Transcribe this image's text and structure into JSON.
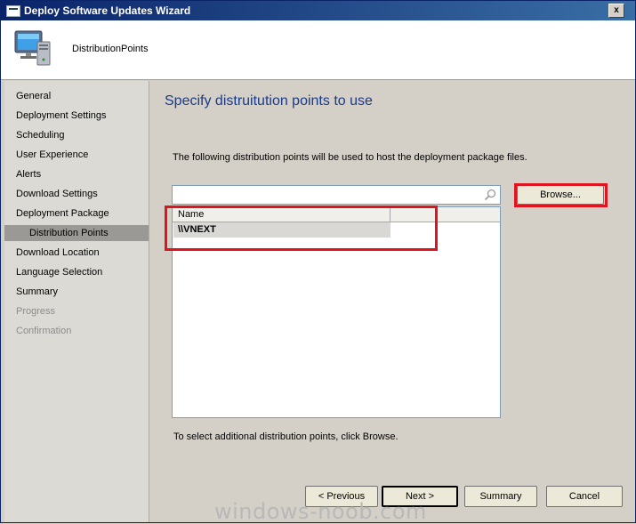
{
  "window": {
    "title": "Deploy Software Updates Wizard",
    "close_glyph": "x"
  },
  "header": {
    "page_name": "DistributionPoints",
    "icon": "computer-icon"
  },
  "sidebar": {
    "items": [
      {
        "label": "General",
        "state": "normal"
      },
      {
        "label": "Deployment Settings",
        "state": "normal"
      },
      {
        "label": "Scheduling",
        "state": "normal"
      },
      {
        "label": "User Experience",
        "state": "normal"
      },
      {
        "label": "Alerts",
        "state": "normal"
      },
      {
        "label": "Download Settings",
        "state": "normal"
      },
      {
        "label": "Deployment Package",
        "state": "normal"
      },
      {
        "label": "Distribution Points",
        "state": "active"
      },
      {
        "label": "Download Location",
        "state": "normal"
      },
      {
        "label": "Language Selection",
        "state": "normal"
      },
      {
        "label": "Summary",
        "state": "normal"
      },
      {
        "label": "Progress",
        "state": "disabled"
      },
      {
        "label": "Confirmation",
        "state": "disabled"
      }
    ]
  },
  "main": {
    "title": "Specify distruitution points to use",
    "description": "The following distribution points will be used to host the deployment package files.",
    "search": {
      "value": "",
      "placeholder": ""
    },
    "browse_label": "Browse...",
    "list": {
      "columns": [
        "Name"
      ],
      "rows": [
        "\\\\VNEXT"
      ]
    },
    "hint": "To select additional distribution points, click Browse."
  },
  "buttons": {
    "previous": "< Previous",
    "next": "Next >",
    "summary": "Summary",
    "cancel": "Cancel"
  },
  "colors": {
    "title_gradient_start": "#0a246a",
    "title_gradient_end": "#3a6ea5",
    "heading": "#1a3a8a",
    "highlight": "#e0141e"
  },
  "watermark": "windows-noob.com"
}
